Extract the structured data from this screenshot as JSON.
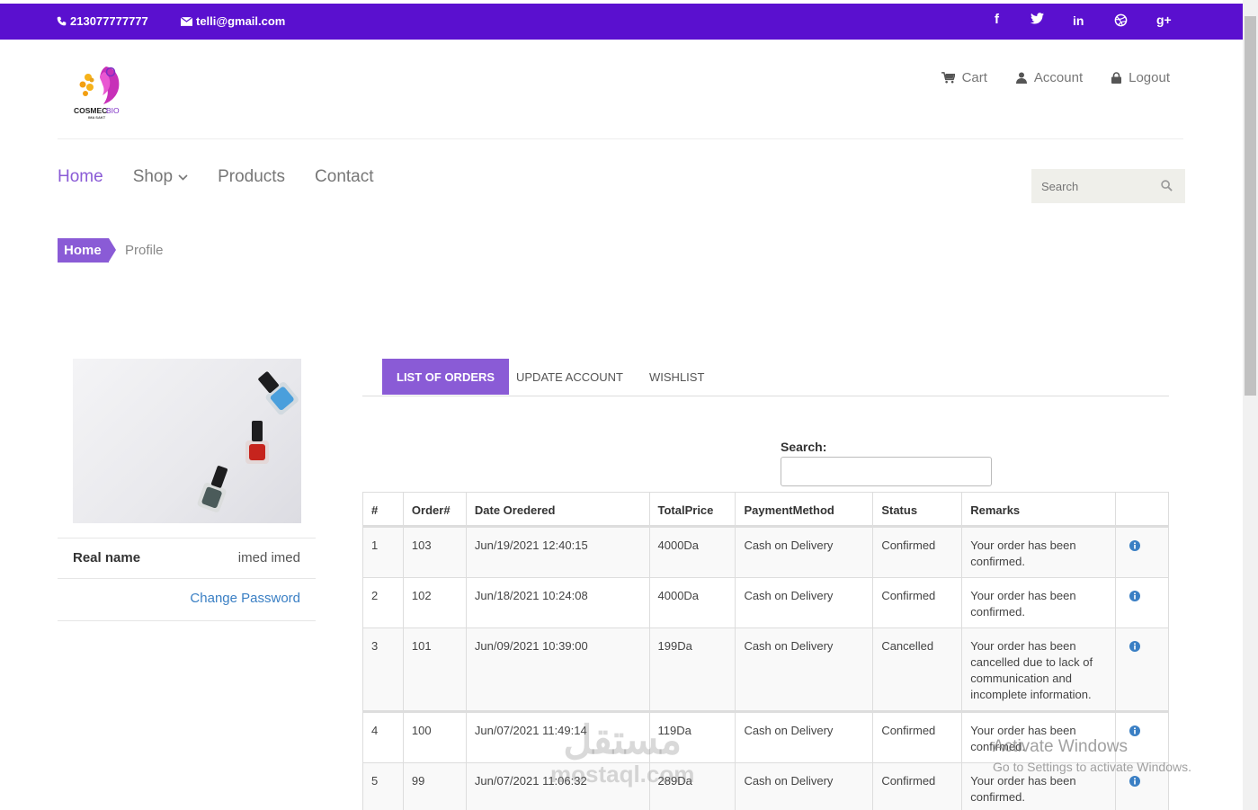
{
  "topbar": {
    "phone": "213077777777",
    "email": "telli@gmail.com",
    "social": [
      {
        "glyph": "f",
        "icon": "facebook-icon"
      },
      {
        "glyph": "🐦",
        "icon": "twitter-icon"
      },
      {
        "glyph": "in",
        "icon": "linkedin-icon"
      },
      {
        "glyph": "⊛",
        "icon": "dribbble-icon"
      },
      {
        "glyph": "g+",
        "icon": "google-plus-icon"
      }
    ],
    "color": "#5a10cf"
  },
  "logo": {
    "text": "COSMEC BIO",
    "sub": "IMA SAKT"
  },
  "header_nav": {
    "cart": "Cart",
    "account": "Account",
    "logout": "Logout"
  },
  "main_nav": {
    "home": "Home",
    "shop": "Shop",
    "products": "Products",
    "contact": "Contact"
  },
  "search": {
    "placeholder": "Search"
  },
  "breadcrumb": {
    "home": "Home",
    "current": "Profile"
  },
  "profile": {
    "real_name_label": "Real name",
    "real_name_value": "imed imed",
    "change_password": "Change Password"
  },
  "tabs": [
    {
      "label": "LIST OF ORDERS",
      "active": true
    },
    {
      "label": "UPDATE ACCOUNT",
      "active": false
    },
    {
      "label": "WISHLIST",
      "active": false
    }
  ],
  "table_search": {
    "label": "Search:"
  },
  "orders": {
    "headers": [
      "#",
      "Order#",
      "Date Oredered",
      "TotalPrice",
      "PaymentMethod",
      "Status",
      "Remarks",
      ""
    ],
    "rows": [
      {
        "n": "1",
        "order": "103",
        "date": "Jun/19/2021 12:40:15",
        "price": "4000Da",
        "payment": "Cash on Delivery",
        "status": "Confirmed",
        "remarks": "Your order has been confirmed."
      },
      {
        "n": "2",
        "order": "102",
        "date": "Jun/18/2021 10:24:08",
        "price": "4000Da",
        "payment": "Cash on Delivery",
        "status": "Confirmed",
        "remarks": "Your order has been confirmed."
      },
      {
        "n": "3",
        "order": "101",
        "date": "Jun/09/2021 10:39:00",
        "price": "199Da",
        "payment": "Cash on Delivery",
        "status": "Cancelled",
        "remarks": "Your order has been cancelled due to lack of communication and incomplete information."
      },
      {
        "n": "4",
        "order": "100",
        "date": "Jun/07/2021 11:49:14",
        "price": "119Da",
        "payment": "Cash on Delivery",
        "status": "Confirmed",
        "remarks": "Your order has been confirmed."
      },
      {
        "n": "5",
        "order": "99",
        "date": "Jun/07/2021 11:06:32",
        "price": "289Da",
        "payment": "Cash on Delivery",
        "status": "Confirmed",
        "remarks": "Your order has been confirmed."
      }
    ]
  },
  "accent": "#8a5bd6",
  "watermark": {
    "arabic": "مستقل",
    "latin": "mostaql.com"
  },
  "os_overlay": {
    "title": "Activate Windows",
    "subtitle": "Go to Settings to activate Windows."
  }
}
